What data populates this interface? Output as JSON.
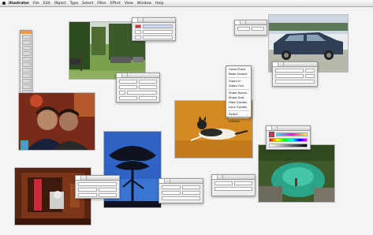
{
  "menubar": {
    "items": [
      "Illustrator",
      "File",
      "Edit",
      "Object",
      "Type",
      "Select",
      "Filter",
      "Effect",
      "View",
      "Window",
      "Help"
    ]
  },
  "context_menu": {
    "items": [
      "Undo Place",
      "Redo Unlock",
      "Zoom In",
      "Zoom Out",
      "Show Rulers",
      "Show Grid",
      "Hide Guides",
      "Lock Guides",
      "Select",
      "Outline"
    ],
    "separators_after": [
      1,
      3,
      7,
      8
    ]
  },
  "colors": {
    "menubar_bg": "#e2e2e2",
    "desktop_bg": "#f4f4f4",
    "panel_bg": "#ececec"
  },
  "icons": [
    "apple-icon",
    "selection-tool-icon",
    "pen-tool-icon",
    "type-tool-icon",
    "fill-swatch-icon",
    "stroke-swatch-icon"
  ]
}
